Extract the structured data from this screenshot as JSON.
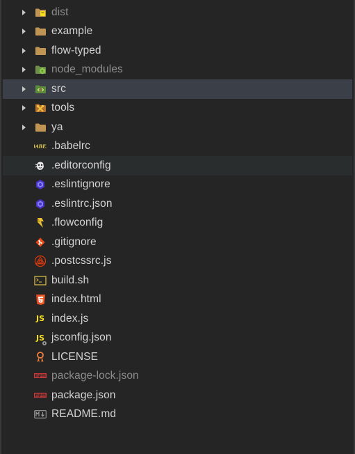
{
  "explorer": {
    "items": [
      {
        "label": "dist",
        "type": "folder",
        "icon": "folder-dist-icon",
        "dim": true
      },
      {
        "label": "example",
        "type": "folder",
        "icon": "folder-icon",
        "dim": false
      },
      {
        "label": "flow-typed",
        "type": "folder",
        "icon": "folder-icon",
        "dim": false
      },
      {
        "label": "node_modules",
        "type": "folder",
        "icon": "folder-node-icon",
        "dim": true
      },
      {
        "label": "src",
        "type": "folder",
        "icon": "folder-src-icon",
        "dim": false,
        "selected": true
      },
      {
        "label": "tools",
        "type": "folder",
        "icon": "folder-tools-icon",
        "dim": false
      },
      {
        "label": "ya",
        "type": "folder",
        "icon": "folder-icon",
        "dim": false
      },
      {
        "label": ".babelrc",
        "type": "file",
        "icon": "babel-icon",
        "dim": false
      },
      {
        "label": ".editorconfig",
        "type": "file",
        "icon": "editorconfig-icon",
        "dim": false,
        "focused": true
      },
      {
        "label": ".eslintignore",
        "type": "file",
        "icon": "eslint-icon",
        "dim": false
      },
      {
        "label": ".eslintrc.json",
        "type": "file",
        "icon": "eslint-icon",
        "dim": false
      },
      {
        "label": ".flowconfig",
        "type": "file",
        "icon": "flow-icon",
        "dim": false
      },
      {
        "label": ".gitignore",
        "type": "file",
        "icon": "git-icon",
        "dim": false
      },
      {
        "label": ".postcssrc.js",
        "type": "file",
        "icon": "postcss-icon",
        "dim": false
      },
      {
        "label": "build.sh",
        "type": "file",
        "icon": "shell-icon",
        "dim": false
      },
      {
        "label": "index.html",
        "type": "file",
        "icon": "html5-icon",
        "dim": false
      },
      {
        "label": "index.js",
        "type": "file",
        "icon": "javascript-icon",
        "dim": false
      },
      {
        "label": "jsconfig.json",
        "type": "file",
        "icon": "jsconfig-icon",
        "dim": false
      },
      {
        "label": "LICENSE",
        "type": "file",
        "icon": "license-icon",
        "dim": false
      },
      {
        "label": "package-lock.json",
        "type": "file",
        "icon": "npm-icon",
        "dim": true
      },
      {
        "label": "package.json",
        "type": "file",
        "icon": "npm-icon",
        "dim": false
      },
      {
        "label": "README.md",
        "type": "file",
        "icon": "markdown-icon",
        "dim": false
      }
    ],
    "icon_glyphs": {
      "javascript": "JS",
      "markdown": "M↓"
    }
  },
  "colors": {
    "background": "#252526",
    "selected_row": "#3b3f47",
    "focused_row": "#2a2d2e",
    "text": "#d4d4d4",
    "dim_text": "#8c8c8c",
    "folder": "#c09553"
  }
}
